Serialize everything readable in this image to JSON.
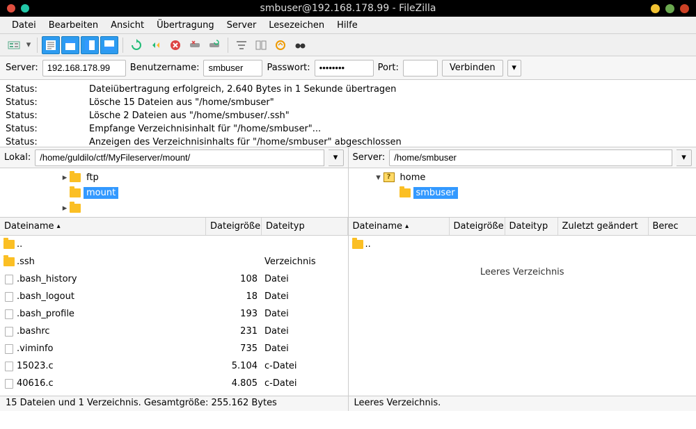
{
  "titlebar": {
    "title": "smbuser@192.168.178.99 - FileZilla",
    "left_dots": [
      "#e04f3f",
      "#22c7a8"
    ],
    "right_dots": [
      "#f1c232",
      "#6aa84f",
      "#cc4125"
    ]
  },
  "menu": [
    "Datei",
    "Bearbeiten",
    "Ansicht",
    "Übertragung",
    "Server",
    "Lesezeichen",
    "Hilfe"
  ],
  "qc": {
    "server_label": "Server:",
    "server_value": "192.168.178.99",
    "user_label": "Benutzername:",
    "user_value": "smbuser",
    "pass_label": "Passwort:",
    "pass_value": "••••••••",
    "port_label": "Port:",
    "port_value": "",
    "connect_label": "Verbinden"
  },
  "log": [
    {
      "label": "Status:",
      "msg": "Dateiübertragung erfolgreich, 2.640 Bytes in 1 Sekunde übertragen"
    },
    {
      "label": "Status:",
      "msg": "Lösche 15 Dateien aus \"/home/smbuser\""
    },
    {
      "label": "Status:",
      "msg": "Lösche 2 Dateien aus \"/home/smbuser/.ssh\""
    },
    {
      "label": "Status:",
      "msg": "Empfange Verzeichnisinhalt für \"/home/smbuser\"..."
    },
    {
      "label": "Status:",
      "msg": "Anzeigen des Verzeichnisinhalts für \"/home/smbuser\" abgeschlossen"
    }
  ],
  "local": {
    "path_label": "Lokal:",
    "path_value": "/home/guldilo/ctf/MyFileserver/mount/",
    "tree": {
      "ftp": "ftp",
      "mount": "mount"
    },
    "cols": {
      "name": "Dateiname",
      "size": "Dateigröße",
      "type": "Dateityp"
    },
    "name_w": 296,
    "size_w": 80,
    "type_w": 118,
    "rows": [
      {
        "icon": "folder",
        "name": "..",
        "size": "",
        "type": ""
      },
      {
        "icon": "folder",
        "name": ".ssh",
        "size": "",
        "type": "Verzeichnis"
      },
      {
        "icon": "file",
        "name": ".bash_history",
        "size": "108",
        "type": "Datei"
      },
      {
        "icon": "file",
        "name": ".bash_logout",
        "size": "18",
        "type": "Datei"
      },
      {
        "icon": "file",
        "name": ".bash_profile",
        "size": "193",
        "type": "Datei"
      },
      {
        "icon": "file",
        "name": ".bashrc",
        "size": "231",
        "type": "Datei"
      },
      {
        "icon": "file",
        "name": ".viminfo",
        "size": "735",
        "type": "Datei"
      },
      {
        "icon": "file",
        "name": "15023.c",
        "size": "5.104",
        "type": "c-Datei"
      },
      {
        "icon": "file",
        "name": "40616.c",
        "size": "4.805",
        "type": "c-Datei"
      }
    ],
    "status": "15 Dateien und 1 Verzeichnis. Gesamtgröße: 255.162 Bytes"
  },
  "remote": {
    "path_label": "Server:",
    "path_value": "/home/smbuser",
    "tree": {
      "home": "home",
      "smbuser": "smbuser"
    },
    "cols": {
      "name": "Dateiname",
      "size": "Dateigröße",
      "type": "Dateityp",
      "mod": "Zuletzt geändert",
      "perm": "Berec"
    },
    "name_w": 145,
    "size_w": 80,
    "type_w": 76,
    "mod_w": 130,
    "perm_w": 50,
    "rows": [
      {
        "icon": "folder",
        "name": "..",
        "size": "",
        "type": "",
        "mod": ""
      }
    ],
    "empty": "Leeres Verzeichnis",
    "status": "Leeres Verzeichnis."
  }
}
